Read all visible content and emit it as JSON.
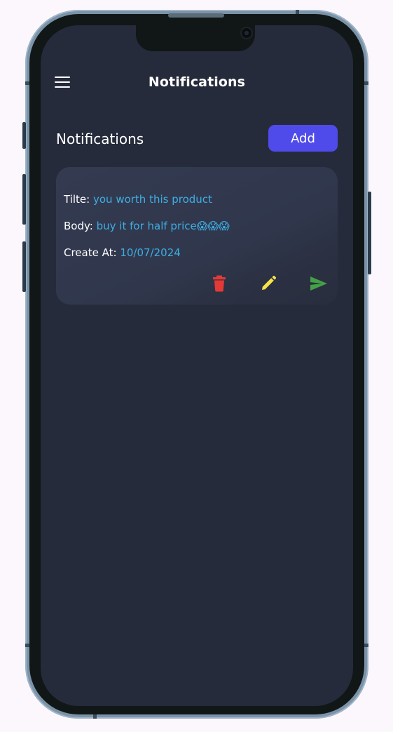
{
  "app_bar": {
    "title": "Notifications",
    "menu_icon": "hamburger-menu-icon"
  },
  "section": {
    "title": "Notifications",
    "add_label": "Add"
  },
  "notifications": [
    {
      "title_label": "Tilte:",
      "title_value": "you worth this product",
      "body_label": "Body:",
      "body_value": "buy it for half price😱😱😱",
      "date_label": "Create At:",
      "date_value": "10/07/2024",
      "actions": {
        "delete_icon": "trash-icon",
        "edit_icon": "pencil-icon",
        "send_icon": "send-icon"
      }
    }
  ],
  "colors": {
    "background": "#252b3b",
    "card": "#30374c",
    "accent": "#4f4bea",
    "value_text": "#3eaee4",
    "delete": "#e53935",
    "edit": "#f7e24a",
    "send": "#43a047"
  }
}
